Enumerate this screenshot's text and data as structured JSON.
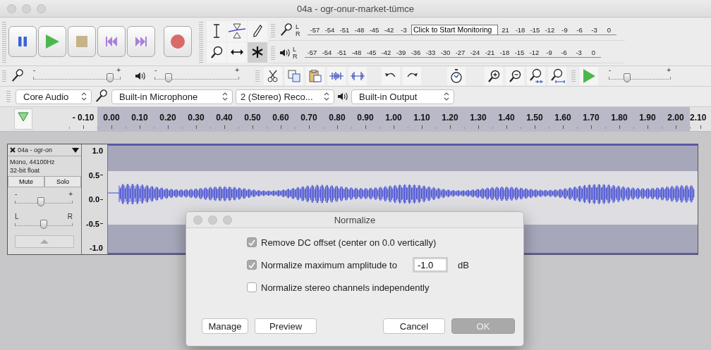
{
  "window": {
    "title": "04a - ogr-onur-market-tümce"
  },
  "tools": [
    {
      "kind": "select",
      "selected": false
    },
    {
      "kind": "envelope",
      "selected": false
    },
    {
      "kind": "draw",
      "selected": false
    },
    {
      "kind": "zoom",
      "selected": false
    },
    {
      "kind": "timeshift",
      "selected": false
    },
    {
      "kind": "multi",
      "selected": true
    }
  ],
  "meters": [
    {
      "kind": "record",
      "channels": [
        "L",
        "R"
      ],
      "scale": [
        "-57",
        "-54",
        "-51",
        "-48",
        "-45",
        "-42",
        "-3"
      ],
      "tooltip": "Click to Start Monitoring",
      "scale_after": [
        "21",
        "-18",
        "-15",
        "-12",
        "-9",
        "-6",
        "-3",
        "0"
      ]
    },
    {
      "kind": "playback",
      "channels": [
        "L",
        "R"
      ],
      "scale": [
        "-57",
        "-54",
        "-51",
        "-48",
        "-45",
        "-42",
        "-39",
        "-36",
        "-33",
        "-30",
        "-27",
        "-24",
        "-21",
        "-18",
        "-15",
        "-12",
        "-9",
        "-6",
        "-3",
        "0"
      ]
    }
  ],
  "mixer": [
    {
      "kind": "record",
      "min_label": "-",
      "max_label": "+",
      "level": 0.88
    },
    {
      "kind": "playback",
      "min_label": "-",
      "max_label": "+",
      "level": 0.17
    }
  ],
  "speed": {
    "min_label": "-",
    "max_label": "+",
    "level": 0.3
  },
  "devices": {
    "host": "Core Audio",
    "input": "Built-in Microphone",
    "channels": "2 (Stereo) Reco...",
    "output": "Built-in Output"
  },
  "timeline": [
    {
      "text": "- 0.10",
      "selected": false
    },
    {
      "text": "0.00",
      "selected": true
    },
    {
      "text": "0.10",
      "selected": true
    },
    {
      "text": "0.20",
      "selected": true
    },
    {
      "text": "0.30",
      "selected": true
    },
    {
      "text": "0.40",
      "selected": true
    },
    {
      "text": "0.50",
      "selected": true
    },
    {
      "text": "0.60",
      "selected": true
    },
    {
      "text": "0.70",
      "selected": true
    },
    {
      "text": "0.80",
      "selected": true
    },
    {
      "text": "0.90",
      "selected": true
    },
    {
      "text": "1.00",
      "selected": true
    },
    {
      "text": "1.10",
      "selected": true
    },
    {
      "text": "1.20",
      "selected": true
    },
    {
      "text": "1.30",
      "selected": true
    },
    {
      "text": "1.40",
      "selected": true
    },
    {
      "text": "1.50",
      "selected": true
    },
    {
      "text": "1.60",
      "selected": true
    },
    {
      "text": "1.70",
      "selected": true
    },
    {
      "text": "1.80",
      "selected": true
    },
    {
      "text": "1.90",
      "selected": true
    },
    {
      "text": "2.00",
      "selected": true
    },
    {
      "text": "2.10",
      "selected": false
    }
  ],
  "track": {
    "name": "04a - ogr-on",
    "info": [
      "Mono, 44100Hz",
      "32-bit float"
    ],
    "mute": "Mute",
    "solo": "Solo",
    "selected": true,
    "gain": {
      "min_label": "-",
      "max_label": "+",
      "level": 0.45
    },
    "pan": {
      "min_label": "L",
      "max_label": "R",
      "level": 0.5
    },
    "scale": [
      "1.0",
      "0.5",
      "0.0",
      "-0.5",
      "-1.0"
    ]
  },
  "dialog": {
    "title": "Normalize",
    "options": [
      {
        "label": "Remove DC offset (center on 0.0 vertically)",
        "checked": true
      },
      {
        "label": "Normalize maximum amplitude to",
        "checked": true,
        "value": "-1.0",
        "unit": "dB"
      },
      {
        "label": "Normalize stereo channels independently",
        "checked": false
      }
    ],
    "buttons": [
      {
        "label": "Manage",
        "default": false
      },
      {
        "label": "Preview",
        "default": false
      },
      {
        "label": "Cancel",
        "default": false
      },
      {
        "label": "OK",
        "default": true
      }
    ]
  }
}
